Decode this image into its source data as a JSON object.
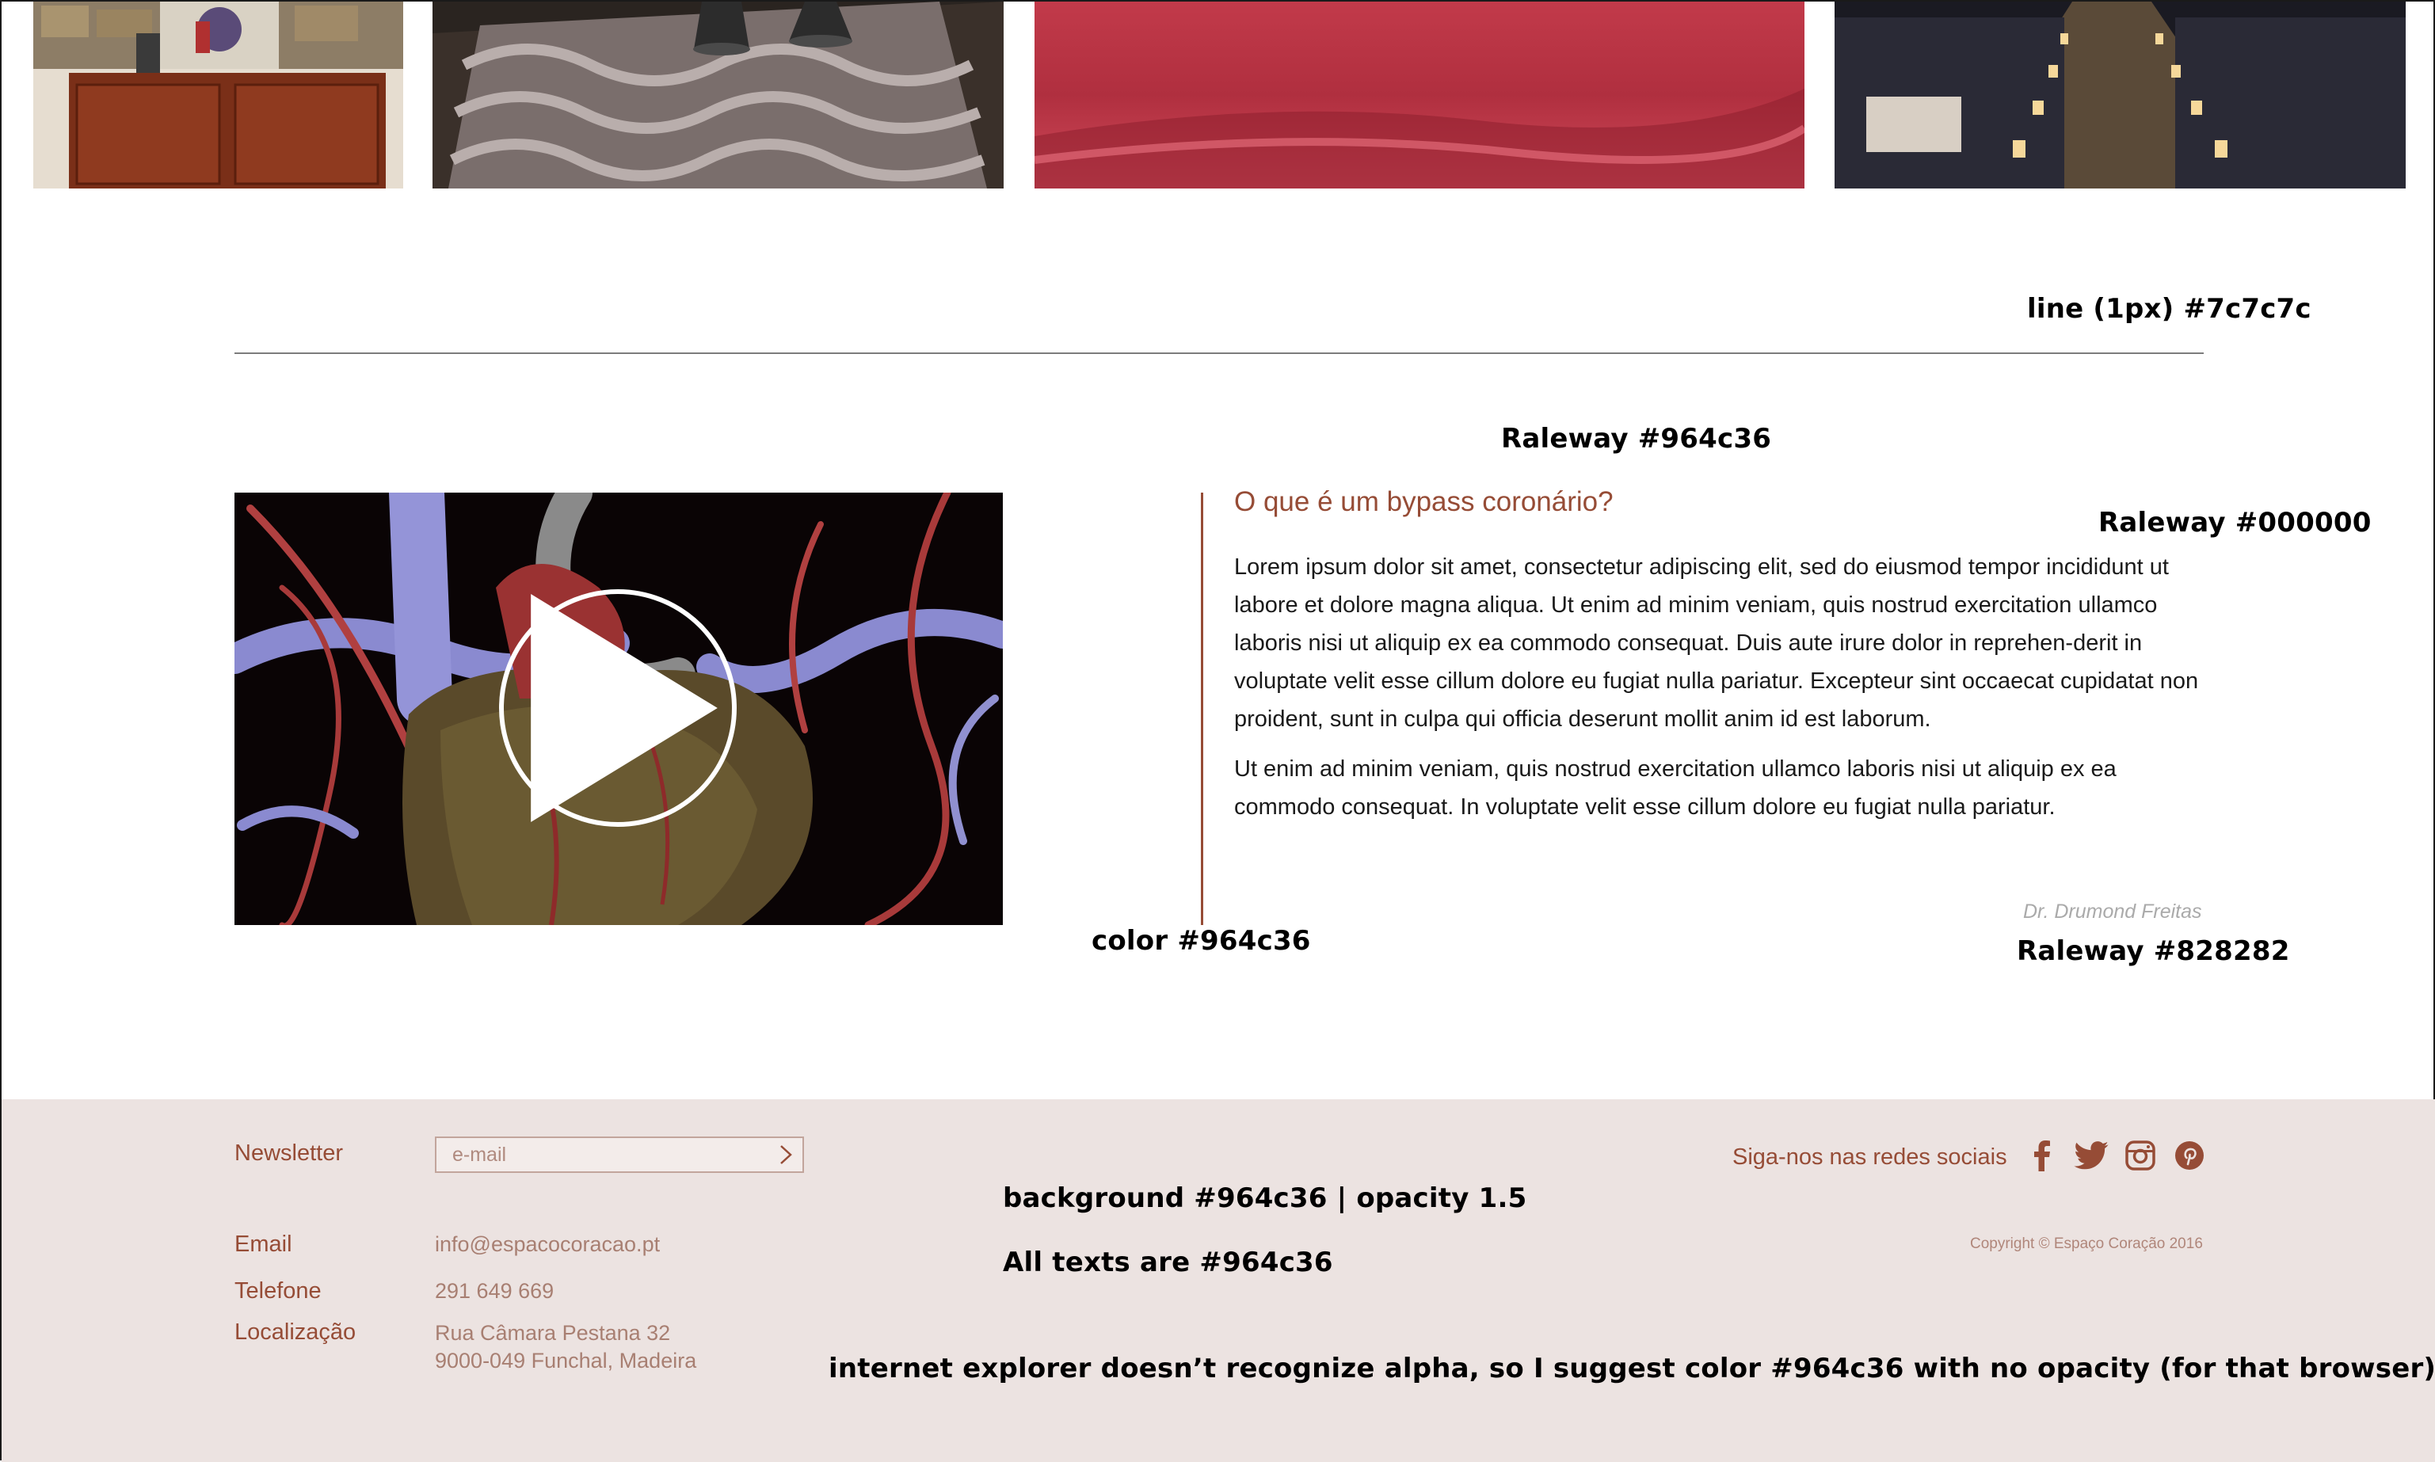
{
  "gallery": {
    "items": [
      {
        "name": "living-room-cabinet"
      },
      {
        "name": "rug-and-vases"
      },
      {
        "name": "red-fabric"
      },
      {
        "name": "candle-lit-aisle"
      }
    ]
  },
  "annotations": {
    "line_note": "line (1px) #7c7c7c",
    "title_font_note": "Raleway #964c36",
    "body_font_note": "Raleway #000000",
    "bar_color_note": "color #964c36",
    "author_font_note": "Raleway #828282",
    "footer_bg_note": "background #964c36  |  opacity 1.5",
    "footer_text_note": "All texts are #964c36",
    "ie_note": "internet explorer doesn’t recognize alpha, so I suggest color #964c36  with no opacity (for that browser)"
  },
  "article": {
    "title": "O que é um bypass coronário?",
    "paragraph_1": "Lorem ipsum dolor sit amet, consectetur adipiscing elit, sed do eiusmod tempor incididunt ut labore et dolore magna aliqua. Ut enim ad minim veniam, quis nostrud exercitation ullamco laboris nisi ut aliquip ex ea commodo consequat. Duis aute irure dolor in reprehen-derit in voluptate velit esse cillum dolore eu fugiat nulla pariatur. Excepteur sint occaecat cupidatat non proident, sunt in culpa qui officia deserunt mollit anim id est laborum.",
    "paragraph_2": "Ut enim ad minim veniam, quis nostrud exercitation ullamco laboris nisi ut aliquip ex ea commodo consequat. In voluptate velit esse cillum dolore eu fugiat nulla pariatur.",
    "author": "Dr. Drumond Freitas"
  },
  "footer": {
    "newsletter_label": "Newsletter",
    "newsletter_placeholder": "e-mail",
    "email_label": "Email",
    "email_value": "info@espacocoracao.pt",
    "phone_label": "Telefone",
    "phone_value": "291 649 669",
    "location_label": "Localização",
    "address_line_1": "Rua Câmara Pestana 32",
    "address_line_2": "9000-049 Funchal, Madeira",
    "social_label": "Siga-nos nas redes sociais",
    "social_icons": [
      "facebook-icon",
      "twitter-icon",
      "instagram-icon",
      "pinterest-icon"
    ],
    "copyright": "Copyright © Espaço Coração 2016"
  },
  "colors": {
    "accent": "#964c36",
    "line": "#7c7c7c",
    "author": "#828282",
    "footer_bg": "#ece3e1"
  }
}
